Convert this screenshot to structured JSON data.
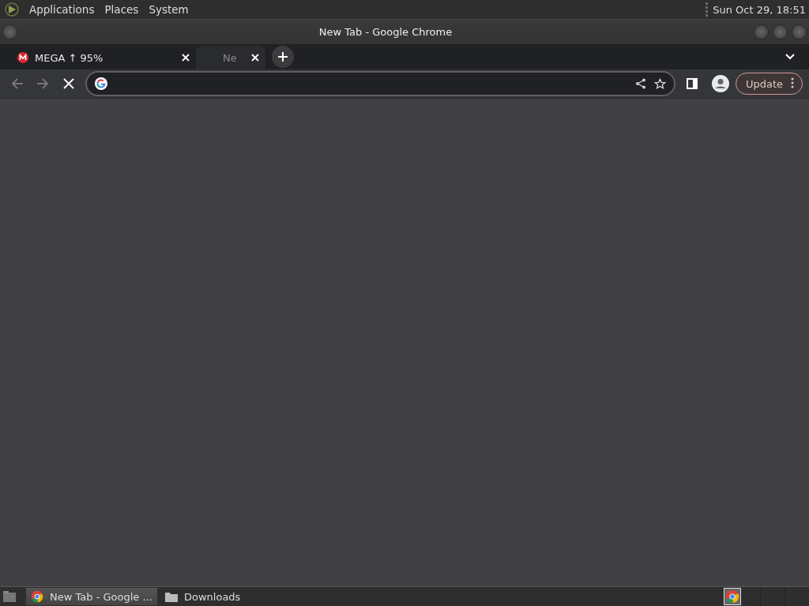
{
  "panel": {
    "menus": [
      "Applications",
      "Places",
      "System"
    ],
    "clock": "Sun Oct 29, 18:51"
  },
  "window": {
    "title": "New Tab - Google Chrome"
  },
  "tabs": [
    {
      "title": "MEGA ↑ 95%",
      "kind": "mega",
      "selected": false
    },
    {
      "title": "Ne",
      "kind": "blank",
      "selected": true
    }
  ],
  "toolbar": {
    "loading": true,
    "update_label": "Update"
  },
  "taskbar": {
    "items": [
      {
        "label": "New Tab - Google ...",
        "kind": "browser",
        "selected": true
      },
      {
        "label": "Downloads",
        "kind": "folder",
        "selected": false
      }
    ]
  }
}
